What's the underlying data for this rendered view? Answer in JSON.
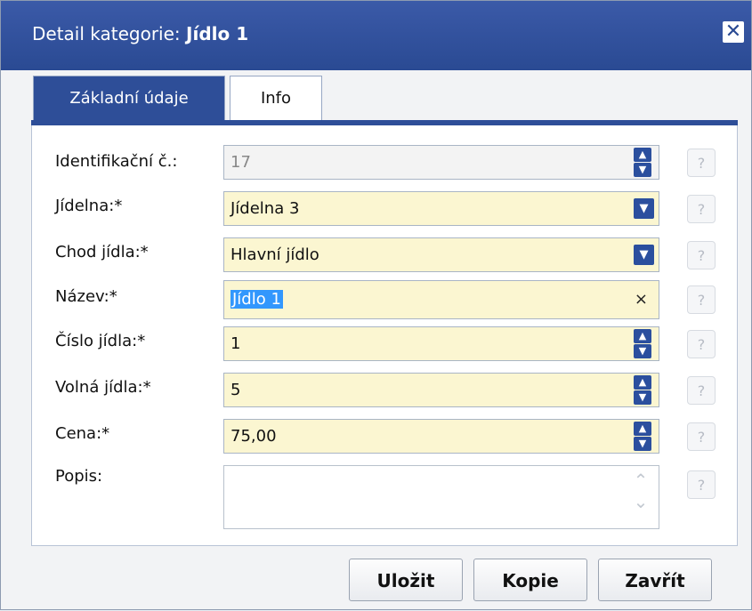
{
  "dialog": {
    "title_prefix": "Detail kategorie: ",
    "title_name": "Jídlo 1",
    "close_symbol": "✕"
  },
  "tabs": [
    {
      "label": "Základní údaje",
      "active": true
    },
    {
      "label": "Info",
      "active": false
    }
  ],
  "form": {
    "id": {
      "label": "Identifikační č.:",
      "value": "17"
    },
    "canteen": {
      "label": "Jídelna:*",
      "value": "Jídelna 3"
    },
    "course": {
      "label": "Chod jídla:*",
      "value": "Hlavní jídlo"
    },
    "name": {
      "label": "Název:*",
      "value": "Jídlo 1",
      "clear_symbol": "×"
    },
    "meal_number": {
      "label": "Číslo jídla:*",
      "value": "1"
    },
    "free_meals": {
      "label": "Volná jídla:*",
      "value": "5"
    },
    "price": {
      "label": "Cena:*",
      "value": "75,00"
    },
    "description": {
      "label": "Popis:",
      "value": ""
    },
    "help_symbol": "?"
  },
  "buttons": {
    "save": "Uložit",
    "copy": "Kopie",
    "close": "Zavřít"
  },
  "colors": {
    "title_bar": "#2a4a93",
    "accent": "#2e4e98",
    "required_field_bg": "#fbf6d1",
    "selection": "#3297fd"
  }
}
